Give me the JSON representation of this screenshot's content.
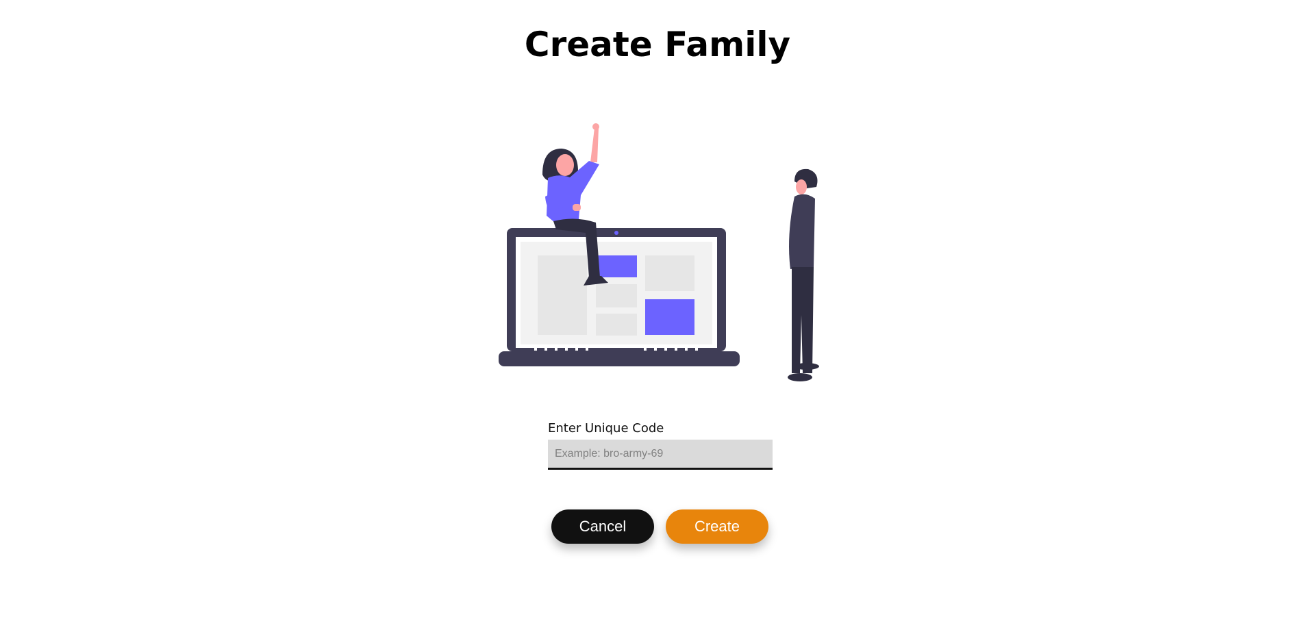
{
  "page": {
    "title": "Create Family"
  },
  "form": {
    "code_label": "Enter Unique Code",
    "code_placeholder": "Example: bro-army-69",
    "code_value": ""
  },
  "actions": {
    "cancel_label": "Cancel",
    "create_label": "Create"
  },
  "colors": {
    "accent": "#e8850c",
    "illustration_accent": "#6c63ff",
    "dark": "#3f3d56"
  }
}
